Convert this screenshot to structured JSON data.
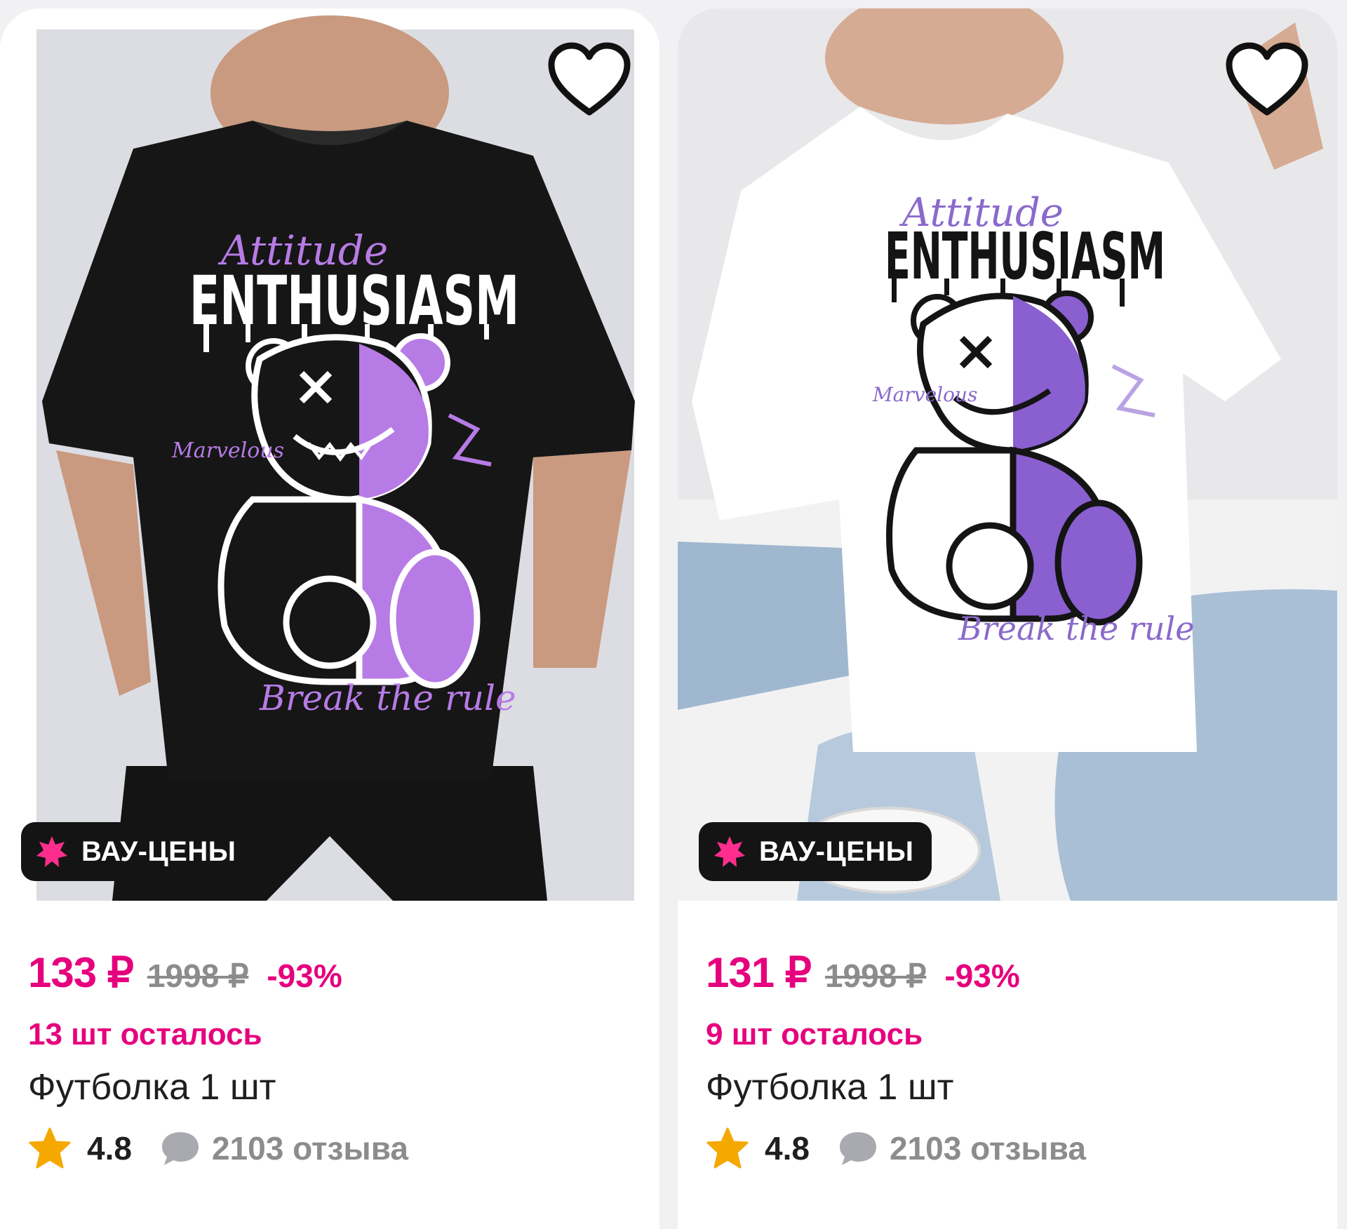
{
  "products": [
    {
      "photo": {
        "print": {
          "script_word": "Attitude",
          "headline": "ENTHUSIASM",
          "side_word": "Marvelous",
          "bottom_text": "Break the rule"
        }
      },
      "badge": "ВАУ-ЦЕНЫ",
      "price": "133 ₽",
      "old_price": "1998 ₽",
      "discount": "-93%",
      "stock": "13 шт осталось",
      "title": "Футболка 1 шт",
      "rating": "4.8",
      "reviews": "2103 отзыва"
    },
    {
      "photo": {
        "print": {
          "script_word": "Attitude",
          "headline": "ENTHUSIASM",
          "side_word": "Marvelous",
          "bottom_text": "Break the rule"
        }
      },
      "badge": "ВАУ-ЦЕНЫ",
      "price": "131 ₽",
      "old_price": "1998 ₽",
      "discount": "-93%",
      "stock": "9 шт осталось",
      "title": "Футболка 1 шт",
      "rating": "4.8",
      "reviews": "2103 отзыва"
    }
  ],
  "icons": {
    "favorite": "heart-outline-icon",
    "badge": "pink-burst-icon",
    "rating": "star-icon",
    "reviews": "speech-bubble-icon"
  },
  "colors": {
    "accent": "#e6007e",
    "star": "#f5a800",
    "old_price": "#8c8c8c",
    "badge_bg": "#141414",
    "print_purple": "#b77be6"
  }
}
